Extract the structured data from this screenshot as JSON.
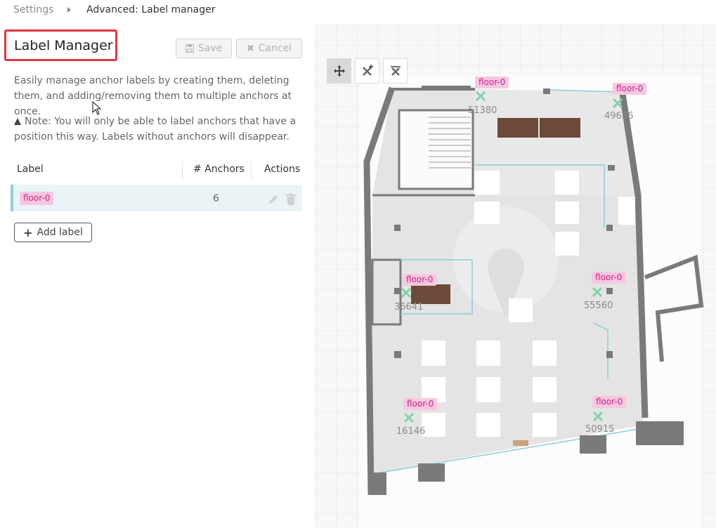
{
  "breadcrumb": {
    "settings": "Settings",
    "current": "Advanced: Label manager"
  },
  "panel": {
    "title": "Label Manager",
    "save_label": "Save",
    "cancel_label": "Cancel",
    "description": "Easily manage anchor labels by creating them, deleting them, and adding/removing them to multiple anchors at once.",
    "note": "Note: You will only be able to label anchors that have a position this way. Labels without anchors will disappear.",
    "table": {
      "headers": {
        "label": "Label",
        "anchors": "# Anchors",
        "actions": "Actions"
      },
      "rows": [
        {
          "label": "floor-0",
          "anchors": "6"
        }
      ]
    },
    "add_label": "Add label"
  },
  "map": {
    "tools": [
      "move-icon",
      "add-anchor-icon",
      "remove-anchor-icon"
    ],
    "anchors": [
      {
        "label": "floor-0",
        "id": "51380"
      },
      {
        "label": "floor-0",
        "id": "49656"
      },
      {
        "label": "floor-0",
        "id": "36641"
      },
      {
        "label": "floor-0",
        "id": "55560"
      },
      {
        "label": "floor-0",
        "id": "16146"
      },
      {
        "label": "floor-0",
        "id": "50915"
      }
    ]
  },
  "colors": {
    "accent_red": "#e0373f",
    "label_bg": "#f8c7e1",
    "label_text": "#d1208a",
    "row_highlight": "#eaf4f6",
    "anchor_green": "#7fd4a8"
  }
}
